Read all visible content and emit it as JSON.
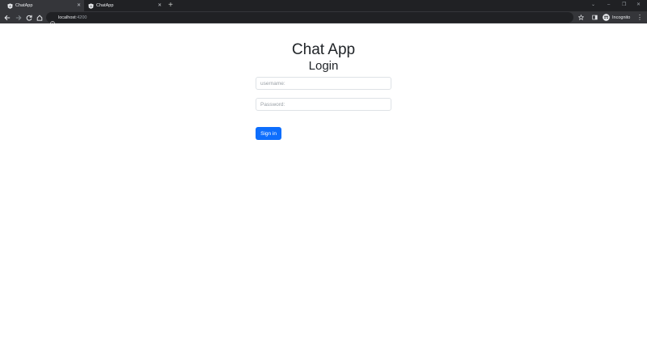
{
  "browser": {
    "tabs": [
      {
        "title": "ChatApp",
        "active": true
      },
      {
        "title": "ChatApp",
        "active": false
      }
    ],
    "new_tab": "+",
    "address": {
      "host": "localhost",
      "port": ":4200"
    },
    "profile_label": "Incognito",
    "accent": "#35363a"
  },
  "page": {
    "app_title": "Chat App",
    "form_title": "Login",
    "username_placeholder": "username:",
    "password_placeholder": "Password:",
    "signin_label": "Sign in",
    "button_color": "#0d6efd"
  }
}
